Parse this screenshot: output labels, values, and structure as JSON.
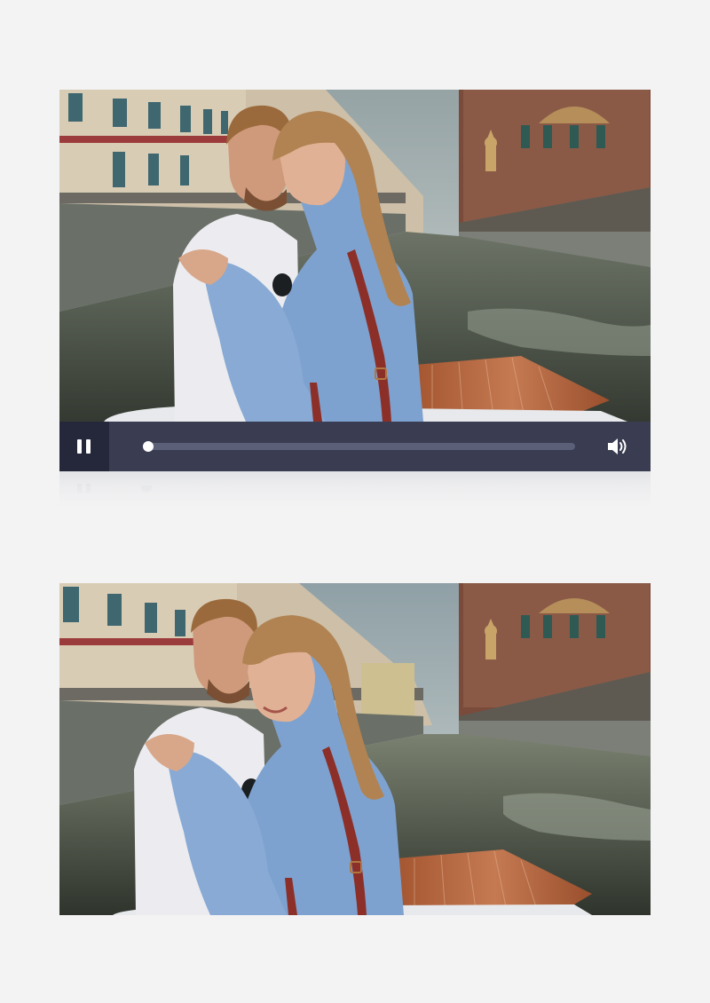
{
  "players": [
    {
      "id": "top",
      "state": "paused-controls-visible",
      "progress_fraction": 0.0,
      "controls": {
        "pause_icon": "pause-icon",
        "volume_icon": "volume-icon"
      }
    },
    {
      "id": "bottom",
      "state": "no-controls"
    }
  ],
  "scene": {
    "description_icon": "video-frame",
    "colors": {
      "sky": "#a9b3b1",
      "water": "#4f5a52",
      "dress": "#7b9fcf",
      "shirt": "#e9e8ec",
      "strap": "#8c2f28",
      "boat_deck": "#b7643f"
    }
  },
  "theme": {
    "control_bar": "#3a3d51",
    "control_bar_dark": "#25283a",
    "track": "#5b5f77",
    "accent": "#ffffff",
    "page_bg": "#f3f3f4"
  }
}
